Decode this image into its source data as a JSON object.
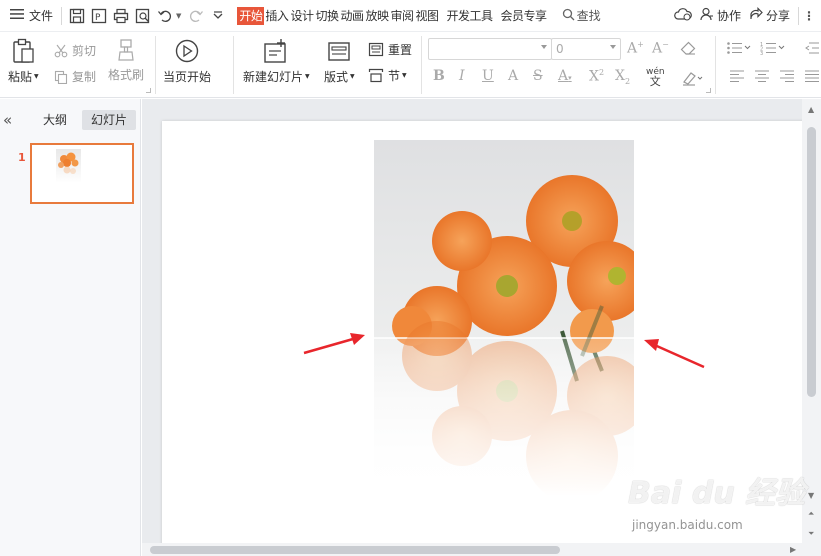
{
  "menubar": {
    "file_label": "文件",
    "tabs": [
      "开始",
      "插入",
      "设计",
      "切换",
      "动画",
      "放映",
      "审阅",
      "视图",
      "开发工具",
      "会员专享"
    ],
    "search_label": "查找",
    "collab_label": "协作",
    "share_label": "分享"
  },
  "ribbon": {
    "paste_label": "粘贴",
    "cut_label": "剪切",
    "copy_label": "复制",
    "format_painter_label": "格式刷",
    "from_current_label": "当页开始",
    "new_slide_label": "新建幻灯片",
    "layout_label": "版式",
    "reset_label": "重置",
    "section_label": "节",
    "font_size_value": "0",
    "font_name_value": ""
  },
  "left_panel": {
    "outline_tab": "大纲",
    "slides_tab": "幻灯片",
    "slide_number": "1"
  },
  "watermark": {
    "main": "Bai du 经验",
    "sub": "jingyan.baidu.com"
  },
  "colors": {
    "accent": "#e8563a",
    "thumb_border": "#e87a3c",
    "annotation_arrow": "#e8262c"
  },
  "icons": [
    "menu-icon",
    "save-icon",
    "export-icon",
    "print-icon",
    "preview-icon",
    "undo-icon",
    "redo-icon",
    "more-icon",
    "search-icon",
    "cloud-icon",
    "user-icon",
    "share-icon"
  ]
}
